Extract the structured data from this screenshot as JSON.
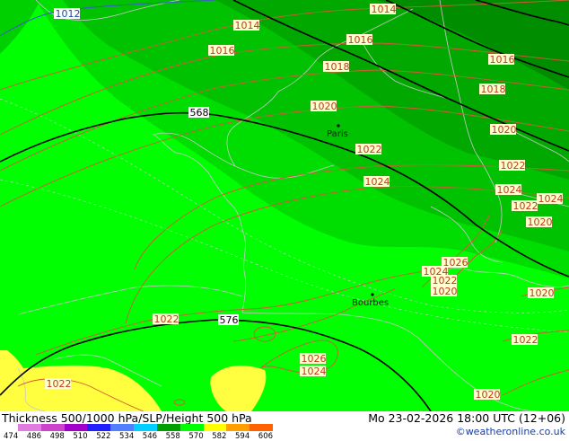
{
  "map": {
    "title": "Thickness 500/1000 hPa/SLP/Height 500 hPa",
    "datetime": "Mo 23-02-2026 18:00 UTC (12+06)",
    "credit": "©weatheronline.co.uk",
    "cities": [
      {
        "name": "Paris"
      },
      {
        "name": "Bourbes"
      }
    ],
    "pressure_labels": [
      "1014",
      "1014",
      "1016",
      "1016",
      "1016",
      "1018",
      "1018",
      "1020",
      "1020",
      "1022",
      "1022",
      "1024",
      "1024",
      "1024",
      "1022",
      "1020",
      "1026",
      "1024",
      "1022",
      "1020",
      "1020",
      "1022",
      "1026",
      "1024",
      "1022",
      "1020",
      "1022"
    ],
    "isobar_blue_labels": [
      "1012"
    ],
    "height_labels": [
      "568",
      "576"
    ],
    "legend": {
      "ticks": [
        "474",
        "486",
        "498",
        "510",
        "522",
        "534",
        "546",
        "558",
        "570",
        "582",
        "594",
        "606"
      ],
      "colors": [
        "#e07be0",
        "#cc44cc",
        "#a000c8",
        "#2020ff",
        "#5080ff",
        "#00d0ff",
        "#00a000",
        "#00ff00",
        "#ffff00",
        "#ffa000",
        "#ff6000"
      ]
    }
  }
}
